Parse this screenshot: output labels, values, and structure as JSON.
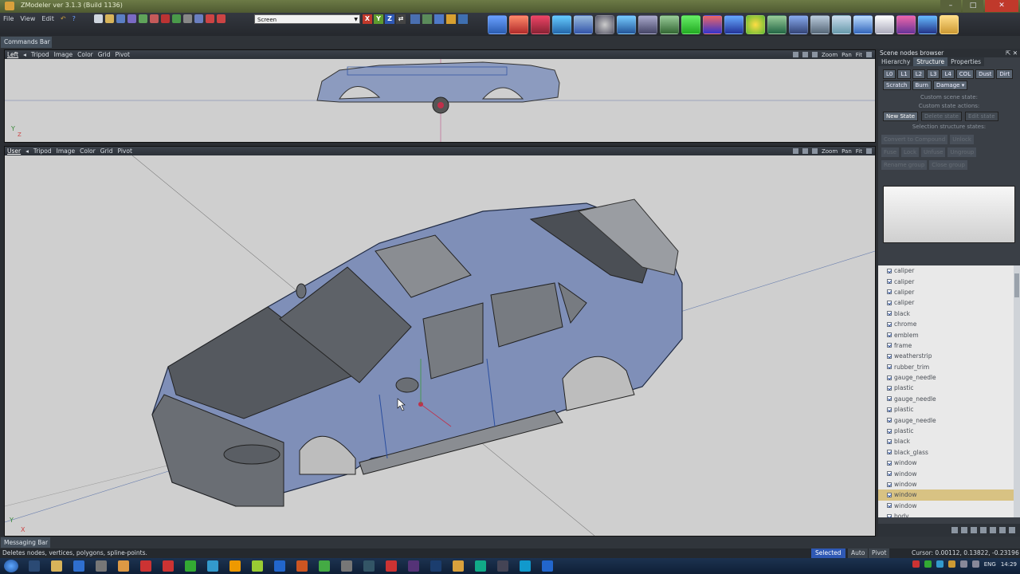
{
  "window": {
    "title": "ZModeler ver 3.1.3 (Build 1136)"
  },
  "menu": {
    "file": "File",
    "view": "View",
    "edit": "Edit"
  },
  "toolbar": {
    "selection_mode": "Screen",
    "axis": [
      "X",
      "Y",
      "Z"
    ]
  },
  "panels": {
    "commands_bar": "Commands Bar",
    "messaging_bar": "Messaging Bar"
  },
  "viewport_top": {
    "name": "Left",
    "menu": [
      "Tripod",
      "Image",
      "Color",
      "Grid",
      "Pivot"
    ],
    "controls": [
      "Zoom",
      "Pan",
      "Fit"
    ]
  },
  "viewport_main": {
    "name": "User",
    "menu": [
      "Tripod",
      "Image",
      "Color",
      "Grid",
      "Pivot"
    ],
    "controls": [
      "Zoom",
      "Pan",
      "Fit"
    ]
  },
  "scene_browser": {
    "title": "Scene nodes browser",
    "tabs": [
      "Hierarchy",
      "Structure",
      "Properties"
    ],
    "state_buttons": [
      "L0",
      "L1",
      "L2",
      "L3",
      "L4",
      "COL",
      "Dust",
      "Dirt",
      "Scratch",
      "Burn",
      "Damage"
    ],
    "custom_scene_state": "Custom scene state:",
    "custom_state_actions": "Custom state actions:",
    "new_state": "New State",
    "delete_state": "Delete state",
    "edit_state": "Edit state",
    "selection_structure_states": "Selection structure states:",
    "convert_to_compound": "Convert to Compound",
    "unlock": "Unlock",
    "faded_row2": [
      "Fuse",
      "Lock",
      "Unfuse",
      "Ungroup"
    ],
    "faded_row3": [
      "Rename group",
      "Close group"
    ],
    "nodes": [
      "caliper",
      "caliper",
      "caliper",
      "caliper",
      "black",
      "chrome",
      "emblem",
      "frame",
      "weatherstrip",
      "rubber_trim",
      "gauge_needle",
      "plastic",
      "gauge_needle",
      "plastic",
      "gauge_needle",
      "plastic",
      "black",
      "black_glass",
      "window",
      "window",
      "window",
      "window",
      "window",
      "body"
    ],
    "selected_index": 21
  },
  "status": {
    "hint": "Deletes nodes, vertices, polygons, spline-points.",
    "selected": "Selected",
    "auto": "Auto",
    "pivot": "Pivot",
    "cursor": "Cursor: 0.00112, 0.13822, -0.23196"
  },
  "taskbar": {
    "language": "ENG",
    "time": "14:29"
  },
  "colors": {
    "title_bar": "#5f6b3c",
    "accent_blue": "#2f59b5",
    "viewport_bg": "#cfcfcf",
    "selected_row": "#d8c283"
  }
}
